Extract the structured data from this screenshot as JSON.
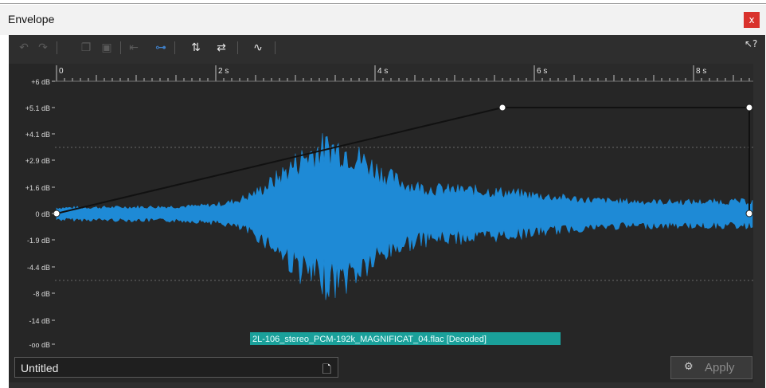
{
  "window": {
    "title": "Envelope",
    "close_glyph": "x"
  },
  "toolbar": {
    "icons": [
      "undo-icon",
      "redo-icon",
      "copy-icon",
      "paste-icon",
      "jump-start-icon",
      "link-icon",
      "flip-vertical-icon",
      "swap-icon",
      "curve-icon",
      "help-pointer-icon"
    ]
  },
  "graph": {
    "y_labels": [
      "+6 dB",
      "+5.1 dB",
      "+4.1 dB",
      "+2.9 dB",
      "+1.6 dB",
      "0 dB",
      "-1.9 dB",
      "-4.4 dB",
      "-8 dB",
      "-14 dB",
      "-oo dB"
    ],
    "x_labels": [
      "0",
      "2 s",
      "4 s",
      "6 s",
      "8 s"
    ],
    "envelope_points": [
      {
        "time_s": 0.0,
        "level_db": 0
      },
      {
        "time_s": 5.6,
        "level_db": 5.1
      },
      {
        "time_s": 8.7,
        "level_db": 5.1
      },
      {
        "time_s": 8.7,
        "level_db": 0
      }
    ],
    "file_label": "2L-106_stereo_PCM-192k_MAGNIFICAT_04.flac [Decoded]",
    "waveform_color": "#1e8ad6",
    "envelope_color": "#111111",
    "file_label_bg": "#1aa09a"
  },
  "bottom": {
    "preset_value": "Untitled",
    "apply_label": "Apply"
  }
}
